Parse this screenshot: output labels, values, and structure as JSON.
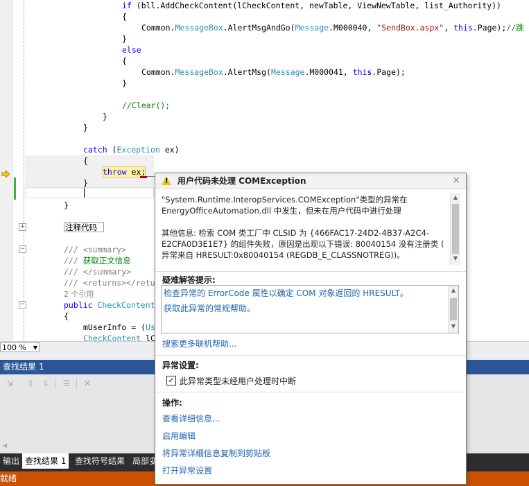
{
  "code": {
    "lines": [
      {
        "id": "l1",
        "segs": [
          [
            "kw",
            "if "
          ],
          [
            "",
            "(bll.AddCheckContent(lCheckContent, newTable, ViewNewTable, list_Authority))"
          ]
        ]
      },
      {
        "id": "l2",
        "segs": [
          [
            "",
            "{"
          ]
        ]
      },
      {
        "id": "l3",
        "segs": [
          [
            "",
            "Common."
          ],
          [
            "ty",
            "MessageBox"
          ],
          [
            "",
            ".AlertMsgAndGo("
          ],
          [
            "ty",
            "Message"
          ],
          [
            "",
            ".M000040, "
          ],
          [
            "st",
            "\"SendBox.aspx\""
          ],
          [
            "",
            ", "
          ],
          [
            "kw",
            "this"
          ],
          [
            "",
            ".Page);"
          ],
          [
            "cm",
            "//跳"
          ]
        ]
      },
      {
        "id": "l4",
        "segs": [
          [
            "",
            "}"
          ]
        ]
      },
      {
        "id": "l5",
        "segs": [
          [
            "kw",
            "else"
          ]
        ]
      },
      {
        "id": "l6",
        "segs": [
          [
            "",
            "{"
          ]
        ]
      },
      {
        "id": "l7",
        "segs": [
          [
            "",
            "Common."
          ],
          [
            "ty",
            "MessageBox"
          ],
          [
            "",
            ".AlertMsg("
          ],
          [
            "ty",
            "Message"
          ],
          [
            "",
            ".M000041, "
          ],
          [
            "kw",
            "this"
          ],
          [
            "",
            ".Page);"
          ]
        ]
      },
      {
        "id": "l8",
        "segs": [
          [
            "",
            "}"
          ]
        ]
      },
      {
        "id": "l9",
        "segs": [
          [
            "cm",
            "//Clear();"
          ]
        ]
      },
      {
        "id": "l10",
        "segs": [
          [
            "",
            "}"
          ]
        ]
      },
      {
        "id": "l11",
        "segs": [
          [
            "",
            "}"
          ]
        ]
      },
      {
        "id": "l12",
        "segs": [
          [
            "kw",
            "catch "
          ],
          [
            "",
            "("
          ],
          [
            "ty",
            "Exception"
          ],
          [
            "",
            " ex)"
          ]
        ]
      },
      {
        "id": "l13",
        "segs": [
          [
            "",
            "{"
          ]
        ]
      },
      {
        "id": "l14",
        "segs": [
          [
            "kw",
            "throw"
          ],
          [
            "",
            " ex;"
          ]
        ]
      },
      {
        "id": "l15",
        "segs": [
          [
            "",
            "}"
          ]
        ]
      },
      {
        "id": "l16",
        "segs": [
          [
            "",
            "}"
          ]
        ]
      },
      {
        "id": "l17",
        "segs": [
          [
            "",
            "注释代码"
          ]
        ]
      },
      {
        "id": "l18",
        "segs": [
          [
            "gr",
            "/// <summary>"
          ]
        ]
      },
      {
        "id": "l19",
        "segs": [
          [
            "gr",
            "/// "
          ],
          [
            "cm",
            "获取正文信息"
          ]
        ]
      },
      {
        "id": "l20",
        "segs": [
          [
            "gr",
            "/// </summary>"
          ]
        ]
      },
      {
        "id": "l21",
        "segs": [
          [
            "gr",
            "/// <returns></retu"
          ]
        ]
      },
      {
        "id": "l22",
        "segs": [
          [
            "ref",
            "2 个引用"
          ]
        ]
      },
      {
        "id": "l23",
        "segs": [
          [
            "kw",
            "public "
          ],
          [
            "ty",
            "CheckContent"
          ]
        ]
      },
      {
        "id": "l24",
        "segs": [
          [
            "",
            "{"
          ]
        ]
      },
      {
        "id": "l25",
        "segs": [
          [
            "",
            "mUserInfo = ("
          ],
          [
            "ty",
            "Us"
          ]
        ]
      },
      {
        "id": "l26",
        "segs": [
          [
            "ty",
            "CheckContent"
          ],
          [
            "",
            " lC"
          ]
        ]
      }
    ]
  },
  "zoom": {
    "value": "100 %"
  },
  "find_panel": {
    "title": "查找结果 1",
    "toolbar_icons": [
      "go-to-icon",
      "prev-result-icon",
      "next-result-icon",
      "clear-icon",
      "stop-icon"
    ]
  },
  "bottom_tabs": [
    {
      "label": "输出"
    },
    {
      "label": "查找结果 1"
    },
    {
      "label": "查找符号结果"
    },
    {
      "label": "局部变"
    }
  ],
  "status": {
    "text": "就绪"
  },
  "exception": {
    "title": "用户代码未处理 COMException",
    "message_lines": [
      "\"System.Runtime.InteropServices.COMException\"类型的异常在",
      "EnergyOfficeAutomation.dll 中发生，但未在用户代码中进行处理",
      "",
      "其他信息: 检索 COM 类工厂中 CLSID 为 {466FAC17-24D2-4B37-A2C4-",
      "E2CFA0D3E1E7} 的组件失败，原因是出现以下错误: 80040154 没有注册类 (",
      "异常来自 HRESULT:0x80040154 (REGDB_E_CLASSNOTREG))。"
    ],
    "tips_heading": "疑难解答提示:",
    "tips": [
      "检查异常的 ErrorCode 属性以确定 COM 对象返回的 HRESULT。",
      "获取此异常的常规帮助。"
    ],
    "search_link": "搜索更多联机帮助...",
    "settings_heading": "异常设置:",
    "checkbox_label": "此异常类型未经用户处理时中断",
    "checkbox_checked": "✓",
    "actions_heading": "操作:",
    "actions": [
      "查看详细信息...",
      "启用编辑",
      "将异常详细信息复制到剪贴板",
      "打开异常设置"
    ]
  }
}
